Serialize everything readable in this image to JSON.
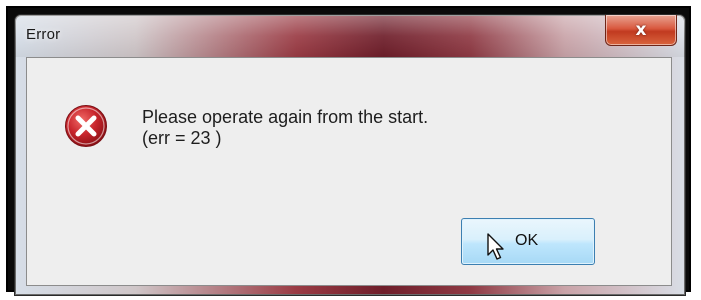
{
  "window": {
    "title": "Error",
    "close_glyph": "x"
  },
  "message": {
    "line1": "Please operate again from the start.",
    "line2": "(err = 23 )"
  },
  "icons": {
    "error": "error-icon",
    "close": "close-icon",
    "cursor": "mouse-pointer-icon"
  },
  "buttons": {
    "ok_label": "OK"
  },
  "colors": {
    "error_red": "#c8252c",
    "close_red": "#c13a20",
    "button_blue": "#bee6fd",
    "client_bg": "#eeeeee"
  }
}
